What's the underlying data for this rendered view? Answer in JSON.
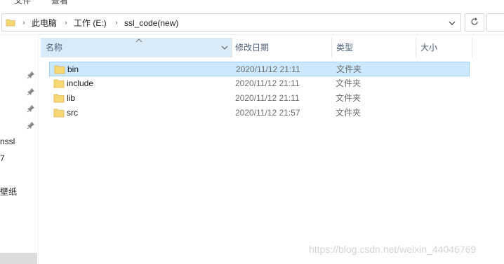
{
  "ribbon": {
    "tab1": "文件",
    "tab2": "查看"
  },
  "address_bar": {
    "breadcrumbs": [
      "此电脑",
      "工作 (E:)",
      "ssl_code(new)"
    ]
  },
  "nav_pane": {
    "items": [
      "nssl",
      "7",
      "壁纸"
    ]
  },
  "columns": {
    "name": "名称",
    "date_modified": "修改日期",
    "type": "类型",
    "size": "大小"
  },
  "files": [
    {
      "name": "bin",
      "date": "2020/11/12 21:11",
      "type": "文件夹",
      "selected": true
    },
    {
      "name": "include",
      "date": "2020/11/12 21:11",
      "type": "文件夹",
      "selected": false
    },
    {
      "name": "lib",
      "date": "2020/11/12 21:11",
      "type": "文件夹",
      "selected": false
    },
    {
      "name": "src",
      "date": "2020/11/12 21:57",
      "type": "文件夹",
      "selected": false
    }
  ],
  "watermark": "https://blog.csdn.net/weixin_44046769",
  "colors": {
    "selected_row_bg": "#cce8ff",
    "selected_row_border": "#99d1ff",
    "sorted_header_bg": "#d9ebf9",
    "folder_yellow": "#f8d775"
  }
}
